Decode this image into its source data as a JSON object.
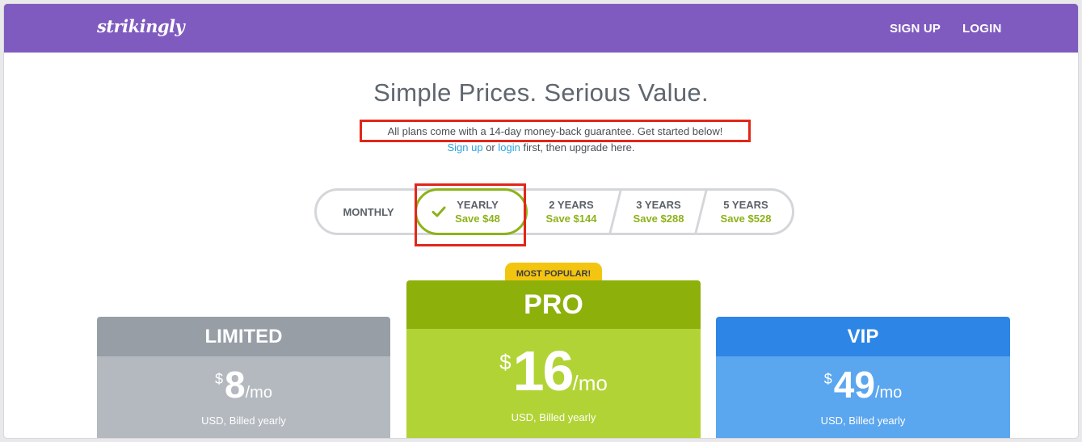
{
  "header": {
    "logo": "strikingly",
    "signup": "SIGN UP",
    "login": "LOGIN",
    "bg_color": "#7f5bbf"
  },
  "hero": {
    "headline": "Simple Prices. Serious Value.",
    "guarantee": "All plans come with a 14-day money-back guarantee. Get started below!",
    "signup_link": "Sign up",
    "or_text": "or",
    "login_link": "login",
    "suffix": "first, then upgrade here."
  },
  "billing": {
    "options": [
      {
        "title": "MONTHLY",
        "save": ""
      },
      {
        "title": "YEARLY",
        "save": "Save $48",
        "selected": true
      },
      {
        "title": "2 YEARS",
        "save": "Save $144"
      },
      {
        "title": "3 YEARS",
        "save": "Save $288"
      },
      {
        "title": "5 YEARS",
        "save": "Save $528"
      }
    ],
    "accent_color": "#8db21a"
  },
  "badge": "MOST POPULAR!",
  "plans": [
    {
      "name": "LIMITED",
      "currency": "$",
      "amount": "8",
      "period": "/mo",
      "billed": "USD, Billed yearly",
      "color": "#979ea6"
    },
    {
      "name": "PRO",
      "currency": "$",
      "amount": "16",
      "period": "/mo",
      "billed": "USD, Billed yearly",
      "color": "#8eb00b"
    },
    {
      "name": "VIP",
      "currency": "$",
      "amount": "49",
      "period": "/mo",
      "billed": "USD, Billed yearly",
      "color": "#2d86e6"
    }
  ],
  "annotations": {
    "highlight_color": "#e0271a"
  }
}
